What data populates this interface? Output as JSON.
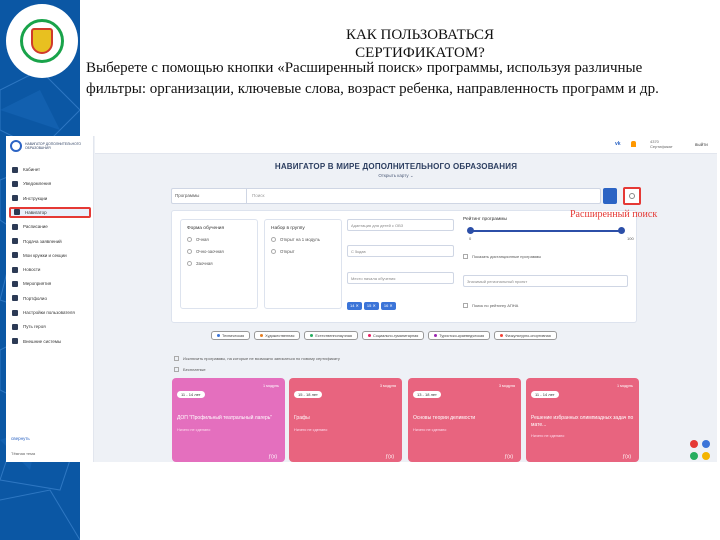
{
  "slide": {
    "title": "КАК ПОЛЬЗОВАТЬСЯ СЕРТИФИКАТОМ?",
    "body": "Выберете с помощью кнопки «Расширенный поиск» программы, используя различные фильтры: организации, ключевые слова, возраст ребенка, направленность программ и др.",
    "annotation": "Расширенный поиск",
    "accent_color": "#e53935",
    "sidebar_color": "#0b57a4"
  },
  "app": {
    "logo_text": "НАВИГАТОР ДОПОЛНИТЕЛЬНОГО ОБРАЗОВАНИЯ",
    "user_lines": [
      "4370",
      "Сертификат"
    ],
    "logout": "выйти",
    "vk": "vk",
    "sidebar": {
      "items": [
        {
          "label": "Кабинет"
        },
        {
          "label": "Уведомления"
        },
        {
          "label": "Инструкции"
        },
        {
          "label": "Навигатор"
        },
        {
          "label": "Расписание"
        },
        {
          "label": "Подача заявлений"
        },
        {
          "label": "Мои кружки и секции"
        },
        {
          "label": "Новости"
        },
        {
          "label": "Мероприятия"
        },
        {
          "label": "Портфолио"
        },
        {
          "label": "Настройки пользователя"
        },
        {
          "label": "Путь героя"
        },
        {
          "label": "Внешние системы"
        }
      ],
      "collapse": "свернуть",
      "theme": "Тёмная тема"
    },
    "header": {
      "title": "НАВИГАТОР В МИРЕ ДОПОЛНИТЕЛЬНОГО ОБРАЗОВАНИЯ",
      "subtitle": "Открыть карту ⌄"
    },
    "search": {
      "type": "Программы",
      "placeholder": "Поиск"
    },
    "filters": {
      "form": {
        "heading": "Форма обучения",
        "options": [
          "Очная",
          "Очно-заочная",
          "Заочная"
        ]
      },
      "group": {
        "heading": "Набор в группу",
        "options": [
          "Открыт на 1 модуль",
          "Открыт"
        ]
      },
      "dropdowns": [
        "Адаптация для детей с ОВЗ",
        "С 5кдав",
        "Место начала обучения"
      ],
      "age_tags": [
        "14 ✕",
        "15 ✕",
        "16 ✕"
      ],
      "rating": {
        "heading": "Рейтинг программы",
        "min": "0",
        "max": "100"
      },
      "checks": [
        "Показать дистанционные программы",
        "Поиск по рейтингу АПНА"
      ],
      "region": "Значимый региональный проект"
    },
    "directions": [
      {
        "label": "Техническая",
        "color": "#3b74d8"
      },
      {
        "label": "Художественная",
        "color": "#e67e22"
      },
      {
        "label": "Естественнонаучная",
        "color": "#27ae60"
      },
      {
        "label": "Социально-гуманитарная",
        "color": "#e91e63"
      },
      {
        "label": "Туристско-краеведческая",
        "color": "#9c27b0"
      },
      {
        "label": "Физкультурно-спортивная",
        "color": "#f44336"
      }
    ],
    "options": [
      "Исключить программы, на которые не возможно записаться по новому сертификату",
      "Бесплатные"
    ],
    "cards": [
      {
        "age": "11 - 14 лет",
        "count": "1 модуль",
        "title": "ДОП \"Профильный театральный лагерь\"",
        "sub": "Ничего не сделано",
        "color": "#e46fbe"
      },
      {
        "age": "15 - 18 лет",
        "count": "3 модуля",
        "title": "Графы",
        "sub": "Ничего не сделано",
        "color": "#e8647f"
      },
      {
        "age": "13 - 18 лет",
        "count": "3 модуля",
        "title": "Основы теории делимости",
        "sub": "Ничего не сделано",
        "color": "#e8647f"
      },
      {
        "age": "11 - 14 лет",
        "count": "1 модуль",
        "title": "Решение избранных олимпиадных задач по мате...",
        "sub": "Ничего не сделано",
        "color": "#e8647f"
      }
    ]
  }
}
